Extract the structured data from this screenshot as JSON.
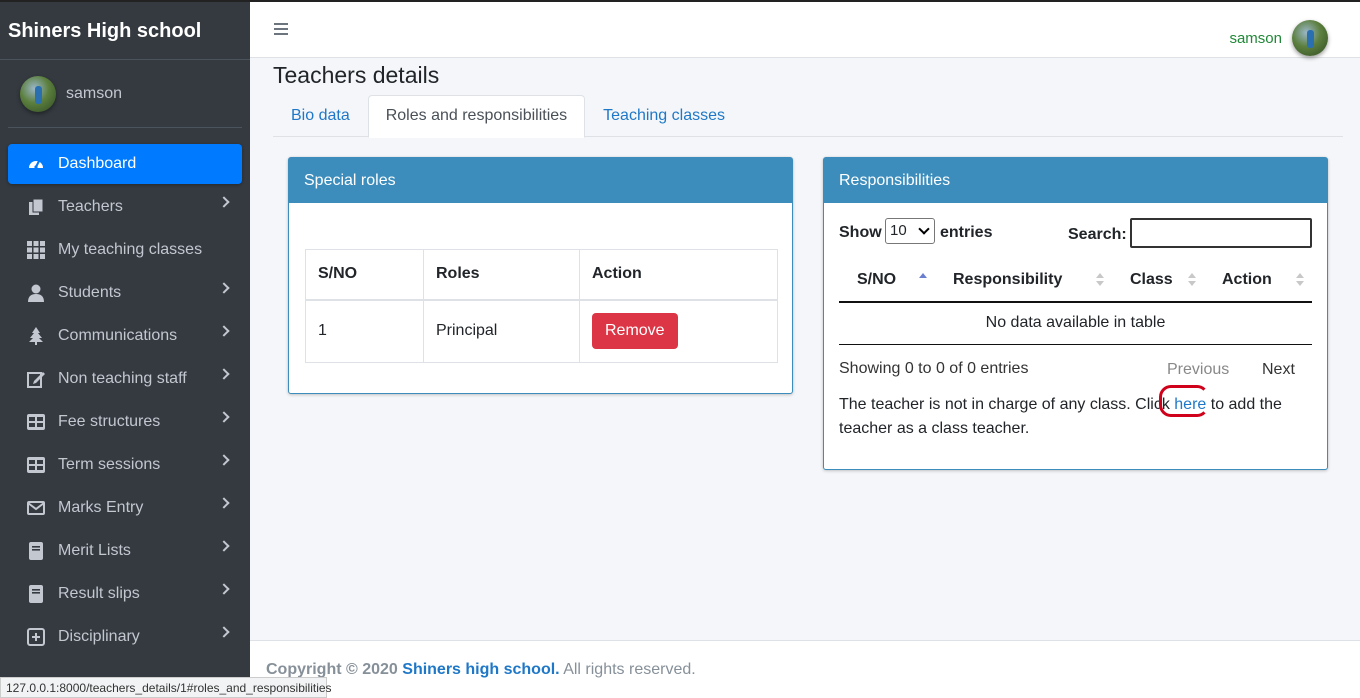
{
  "brand": "Shiners High school",
  "user": {
    "name": "samson"
  },
  "sidebar": {
    "items": [
      {
        "label": "Dashboard",
        "icon": "dashboard-icon"
      },
      {
        "label": "Teachers",
        "icon": "copy-icon"
      },
      {
        "label": "My teaching classes",
        "icon": "grid-icon"
      },
      {
        "label": "Students",
        "icon": "user-icon"
      },
      {
        "label": "Communications",
        "icon": "tree-icon"
      },
      {
        "label": "Non teaching staff",
        "icon": "edit-icon"
      },
      {
        "label": "Fee structures",
        "icon": "table-icon"
      },
      {
        "label": "Term sessions",
        "icon": "table-icon"
      },
      {
        "label": "Marks Entry",
        "icon": "envelope-icon"
      },
      {
        "label": "Merit Lists",
        "icon": "book-icon"
      },
      {
        "label": "Result slips",
        "icon": "book-icon"
      },
      {
        "label": "Disciplinary",
        "icon": "plus-square-icon"
      }
    ]
  },
  "header": {
    "username": "samson"
  },
  "page": {
    "title": "Teachers details",
    "tabs": [
      "Bio data",
      "Roles and responsibilities",
      "Teaching classes"
    ]
  },
  "special_roles": {
    "title": "Special roles",
    "columns": [
      "S/NO",
      "Roles",
      "Action"
    ],
    "rows": [
      {
        "sno": "1",
        "role": "Principal",
        "action": "Remove"
      }
    ]
  },
  "responsibilities": {
    "title": "Responsibilities",
    "show_label": "Show",
    "length_value": "10",
    "entries_label": "entries",
    "search_label": "Search:",
    "columns": [
      "S/NO",
      "Responsibility",
      "Class",
      "Action"
    ],
    "empty_text": "No data available in table",
    "info": "Showing 0 to 0 of 0 entries",
    "prev": "Previous",
    "next": "Next",
    "note_before": "The teacher is not in charge of any class. Click ",
    "note_link": "here",
    "note_after": " to add the teacher as a class teacher."
  },
  "footer": {
    "prefix": "Copyright © 2020 ",
    "link": "Shiners high school.",
    "suffix": " All rights reserved."
  },
  "status_url": "127.0.0.1:8000/teachers_details/1#roles_and_responsibilities"
}
